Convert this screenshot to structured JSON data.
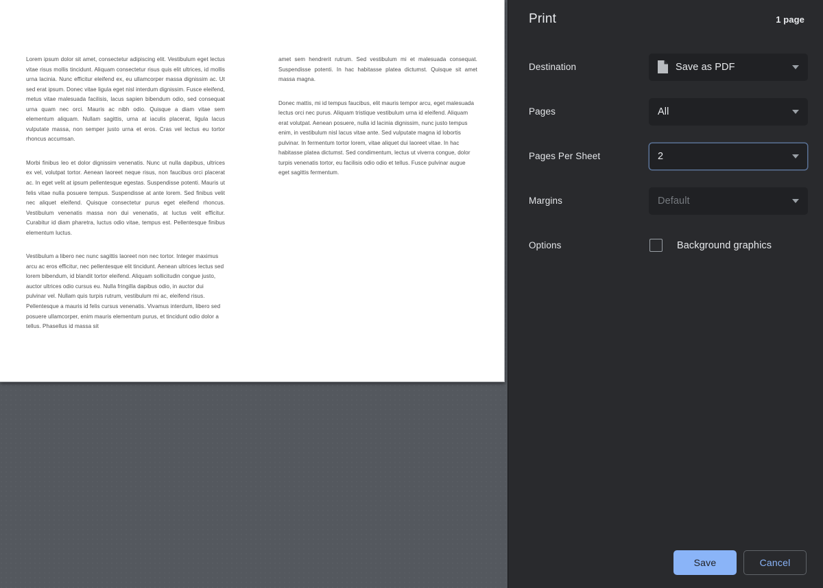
{
  "preview": {
    "document": {
      "columns": [
        {
          "paragraphs": [
            {
              "align": "justify",
              "text": "Lorem ipsum dolor sit amet, consectetur adipiscing elit. Vestibulum eget lectus vitae risus mollis tincidunt. Aliquam consectetur risus quis elit ultrices, id mollis urna lacinia. Nunc efficitur eleifend ex, eu ullamcorper massa dignissim ac. Ut sed erat ipsum. Donec vitae ligula eget nisl interdum dignissim. Fusce eleifend, metus vitae malesuada facilisis, lacus sapien bibendum odio, sed consequat urna quam nec orci. Mauris ac nibh odio. Quisque a diam vitae sem elementum aliquam. Nullam sagittis, urna at iaculis placerat, ligula lacus vulputate massa, non semper justo urna et eros. Cras vel lectus eu tortor rhoncus accumsan."
            },
            {
              "align": "justify",
              "text": "Morbi finibus leo et dolor dignissim venenatis. Nunc ut nulla dapibus, ultrices ex vel, volutpat tortor. Aenean laoreet neque risus, non faucibus orci placerat ac. In eget velit at ipsum pellentesque egestas. Suspendisse potenti. Mauris ut felis vitae nulla posuere tempus. Suspendisse at ante lorem. Sed finibus velit nec aliquet eleifend. Quisque consectetur purus eget eleifend rhoncus. Vestibulum venenatis massa non dui venenatis, at luctus velit efficitur. Curabitur id diam pharetra, luctus odio vitae, tempus est. Pellentesque finibus elementum luctus."
            },
            {
              "align": "left",
              "text": "Vestibulum a libero nec nunc sagittis laoreet non nec tortor. Integer maximus arcu ac eros efficitur, nec pellentesque elit tincidunt. Aenean ultrices lectus sed lorem bibendum, id blandit tortor eleifend. Aliquam sollicitudin congue justo, auctor ultrices odio cursus eu. Nulla fringilla dapibus odio, in auctor dui pulvinar vel. Nullam quis turpis rutrum, vestibulum mi ac, eleifend risus. Pellentesque a mauris id felis cursus venenatis. Vivamus interdum, libero sed posuere ullamcorper, enim mauris elementum purus, et tincidunt odio dolor a tellus. Phasellus id massa sit"
            }
          ]
        },
        {
          "paragraphs": [
            {
              "align": "justify",
              "text": "amet sem hendrerit rutrum. Sed vestibulum mi et malesuada consequat. Suspendisse potenti. In hac habitasse platea dictumst. Quisque sit amet massa magna."
            },
            {
              "align": "left",
              "text": "Donec mattis, mi id tempus faucibus, elit mauris tempor arcu, eget malesuada lectus orci nec purus. Aliquam tristique vestibulum urna id eleifend. Aliquam erat volutpat. Aenean posuere, nulla id lacinia dignissim, nunc justo tempus enim, in vestibulum nisl lacus vitae ante. Sed vulputate magna id lobortis pulvinar. In fermentum tortor lorem, vitae aliquet dui laoreet vitae. In hac habitasse platea dictumst. Sed condimentum, lectus ut viverra congue, dolor turpis venenatis tortor, eu facilisis odio odio et tellus. Fusce pulvinar augue eget sagittis fermentum."
            }
          ]
        }
      ]
    }
  },
  "panel": {
    "title": "Print",
    "page_count": "1 page",
    "destination": {
      "label": "Destination",
      "value": "Save as PDF",
      "icon": "document-icon"
    },
    "pages": {
      "label": "Pages",
      "value": "All"
    },
    "pages_per_sheet": {
      "label": "Pages Per Sheet",
      "value": "2"
    },
    "margins": {
      "label": "Margins",
      "value": "Default"
    },
    "options": {
      "label": "Options",
      "background_graphics_label": "Background graphics",
      "background_graphics_checked": false
    },
    "footer": {
      "save_label": "Save",
      "cancel_label": "Cancel"
    },
    "colors": {
      "panel_background": "#292a2d",
      "control_background": "#202124",
      "accent": "#8ab4f8",
      "text": "#e8eaed",
      "disabled_text": "#767a7f",
      "preview_background": "#54585e"
    }
  }
}
